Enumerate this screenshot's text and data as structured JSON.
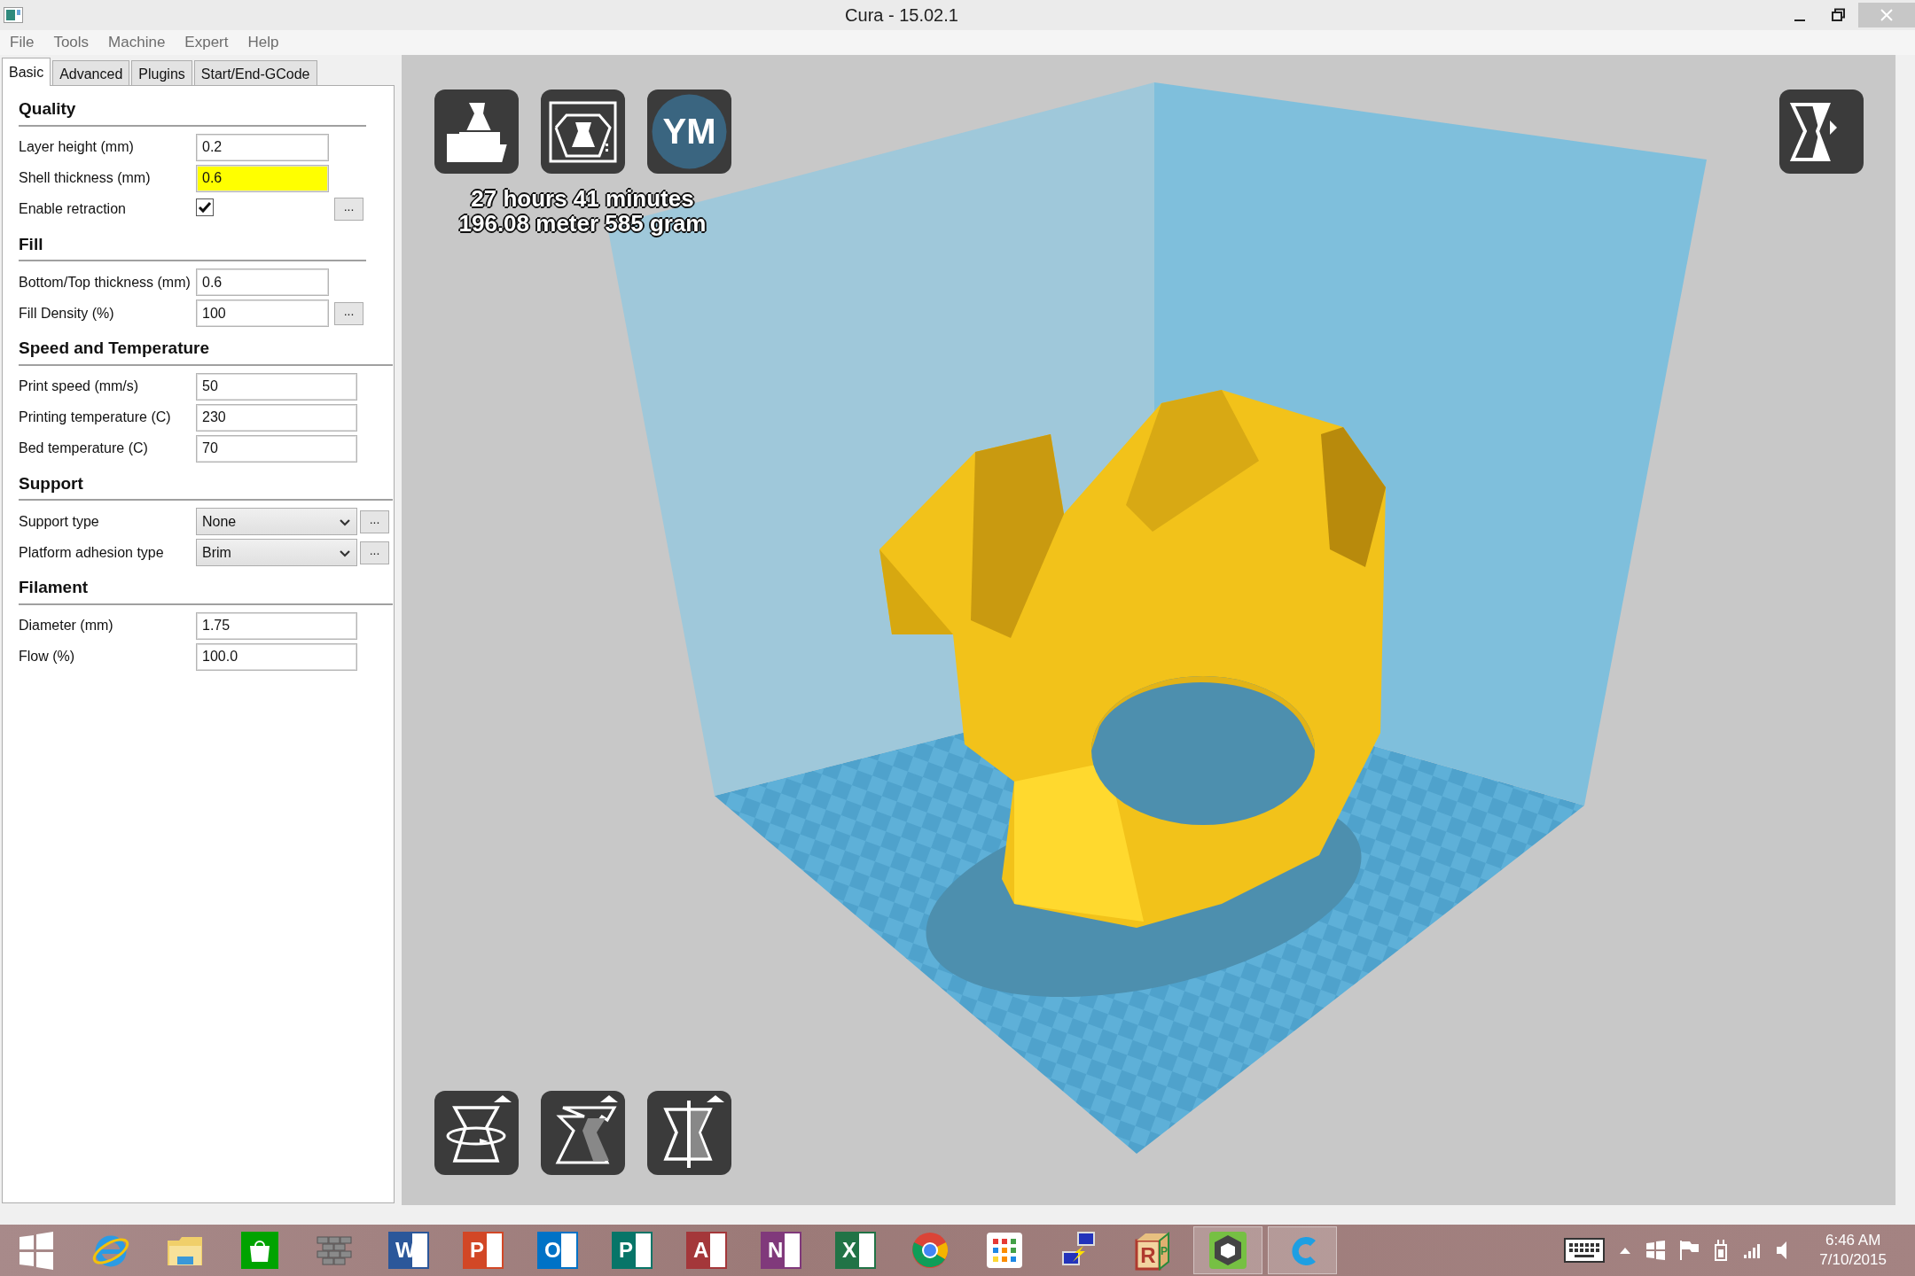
{
  "window": {
    "title": "Cura - 15.02.1"
  },
  "menu": [
    "File",
    "Tools",
    "Machine",
    "Expert",
    "Help"
  ],
  "tabs": [
    {
      "label": "Basic",
      "selected": true
    },
    {
      "label": "Advanced",
      "selected": false
    },
    {
      "label": "Plugins",
      "selected": false
    },
    {
      "label": "Start/End-GCode",
      "selected": false
    }
  ],
  "sections": [
    {
      "title": "Quality",
      "settings": [
        {
          "label": "Layer height (mm)",
          "kind": "text",
          "value": "0.2",
          "warning": false
        },
        {
          "label": "Shell thickness (mm)",
          "kind": "text",
          "value": "0.6",
          "warning": true
        },
        {
          "label": "Enable retraction",
          "kind": "checkbox",
          "checked": true,
          "more_button": "..."
        }
      ]
    },
    {
      "title": "Fill",
      "settings": [
        {
          "label": "Bottom/Top thickness (mm)",
          "kind": "text",
          "value": "0.6",
          "warning": false
        },
        {
          "label": "Fill Density (%)",
          "kind": "text",
          "value": "100",
          "warning": false,
          "more_button": "..."
        }
      ]
    },
    {
      "title": "Speed and Temperature",
      "settings": [
        {
          "label": "Print speed (mm/s)",
          "kind": "text",
          "value": "50",
          "warning": false
        },
        {
          "label": "Printing temperature (C)",
          "kind": "text",
          "value": "230",
          "warning": false
        },
        {
          "label": "Bed temperature (C)",
          "kind": "text",
          "value": "70",
          "warning": false
        }
      ]
    },
    {
      "title": "Support",
      "settings": [
        {
          "label": "Support type",
          "kind": "select",
          "value": "None",
          "more_button": "..."
        },
        {
          "label": "Platform adhesion type",
          "kind": "select",
          "value": "Brim",
          "more_button": "..."
        }
      ]
    },
    {
      "title": "Filament",
      "settings": [
        {
          "label": "Diameter (mm)",
          "kind": "text",
          "value": "1.75",
          "warning": false
        },
        {
          "label": "Flow (%)",
          "kind": "text",
          "value": "100.0",
          "warning": false
        }
      ]
    }
  ],
  "viewport": {
    "print_time": "27 hours 41 minutes",
    "print_usage": "196.08 meter 585 gram",
    "user_badge": "YM"
  },
  "taskbar": {
    "items": [
      {
        "kind": "windows",
        "active": false
      },
      {
        "kind": "ie",
        "active": false
      },
      {
        "kind": "folder",
        "active": false
      },
      {
        "kind": "store",
        "active": false
      },
      {
        "kind": "bricks",
        "active": false
      },
      {
        "kind": "letter",
        "glyph": "W",
        "color": "#2b579a",
        "active": false
      },
      {
        "kind": "letter",
        "glyph": "P",
        "color": "#d24726",
        "active": false
      },
      {
        "kind": "letter",
        "glyph": "O",
        "color": "#0072c6",
        "active": false
      },
      {
        "kind": "letter",
        "glyph": "P",
        "color": "#077568",
        "active": false
      },
      {
        "kind": "letter",
        "glyph": "A",
        "color": "#a4373a",
        "active": false
      },
      {
        "kind": "letter",
        "glyph": "N",
        "color": "#80397b",
        "active": false
      },
      {
        "kind": "letter",
        "glyph": "X",
        "color": "#217346",
        "active": false
      },
      {
        "kind": "chrome",
        "active": false
      },
      {
        "kind": "grid",
        "active": false
      },
      {
        "kind": "network",
        "active": false
      },
      {
        "kind": "cube",
        "glyphs": [
          "R",
          "P"
        ],
        "active": false
      },
      {
        "kind": "hexagon",
        "active": true
      },
      {
        "kind": "cura",
        "active": true
      }
    ],
    "time": "6:46 AM",
    "date": "7/10/2015"
  }
}
